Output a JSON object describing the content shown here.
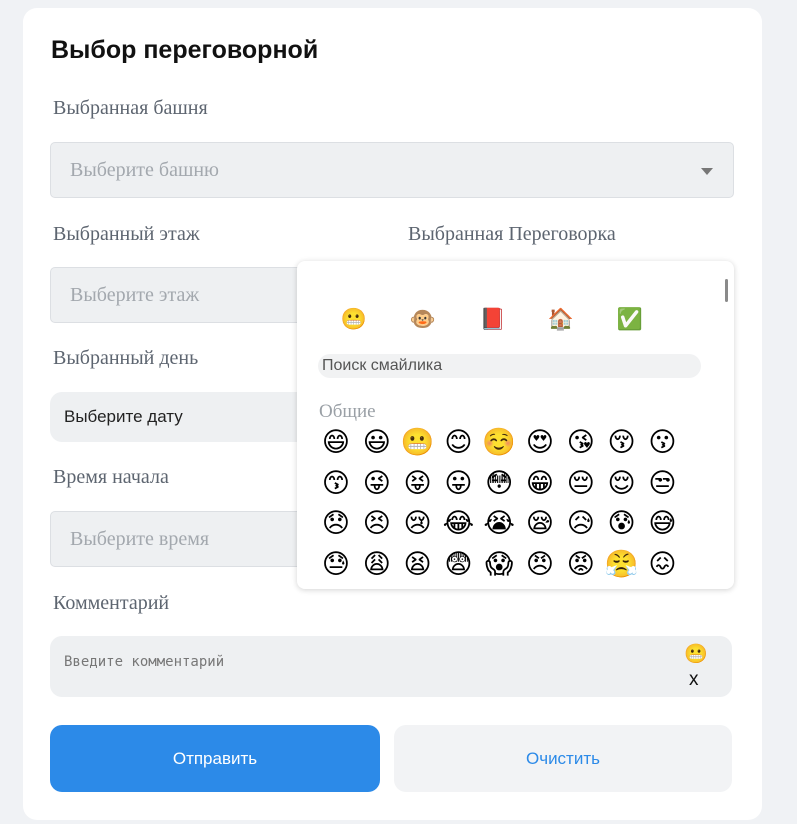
{
  "form": {
    "title": "Выбор переговорной",
    "tower": {
      "label": "Выбранная башня",
      "placeholder": "Выберите башню"
    },
    "floor": {
      "label": "Выбранный этаж",
      "placeholder": "Выберите этаж"
    },
    "room": {
      "label": "Выбранная Переговорка"
    },
    "day": {
      "label": "Выбранный день",
      "placeholder": "Выберите дату"
    },
    "start_time": {
      "label": "Время начала",
      "placeholder": "Выберите время"
    },
    "comment": {
      "label": "Комментарий",
      "placeholder": "Введите комментарий",
      "emoji_button": "😬",
      "clear_button": "x"
    },
    "buttons": {
      "submit": "Отправить",
      "clear": "Очистить"
    }
  },
  "emoji_picker": {
    "categories": [
      {
        "name": "smileys",
        "icon": "😬"
      },
      {
        "name": "animals",
        "icon": "🐵"
      },
      {
        "name": "objects",
        "icon": "📕"
      },
      {
        "name": "places",
        "icon": "🏠"
      },
      {
        "name": "symbols",
        "icon": "✅"
      }
    ],
    "search_placeholder": "Поиск смайлика",
    "section_title": "Общие",
    "emojis": [
      [
        "😄",
        "😃",
        "😬",
        "😊",
        "☺️",
        "😍",
        "😘",
        "😚",
        "😗"
      ],
      [
        "😙",
        "😜",
        "😝",
        "😛",
        "😳",
        "😁",
        "😔",
        "😌",
        "😒"
      ],
      [
        "😞",
        "😣",
        "😢",
        "😂",
        "😭",
        "😪",
        "😥",
        "😰",
        "😅"
      ],
      [
        "😓",
        "😩",
        "😫",
        "😨",
        "😱",
        "😠",
        "😡",
        "😤",
        "😖"
      ]
    ]
  },
  "colors": {
    "primary": "#2c8ae8",
    "field_bg": "#eef0f2",
    "card_bg": "#ffffff",
    "page_bg": "#f0f2f5"
  }
}
